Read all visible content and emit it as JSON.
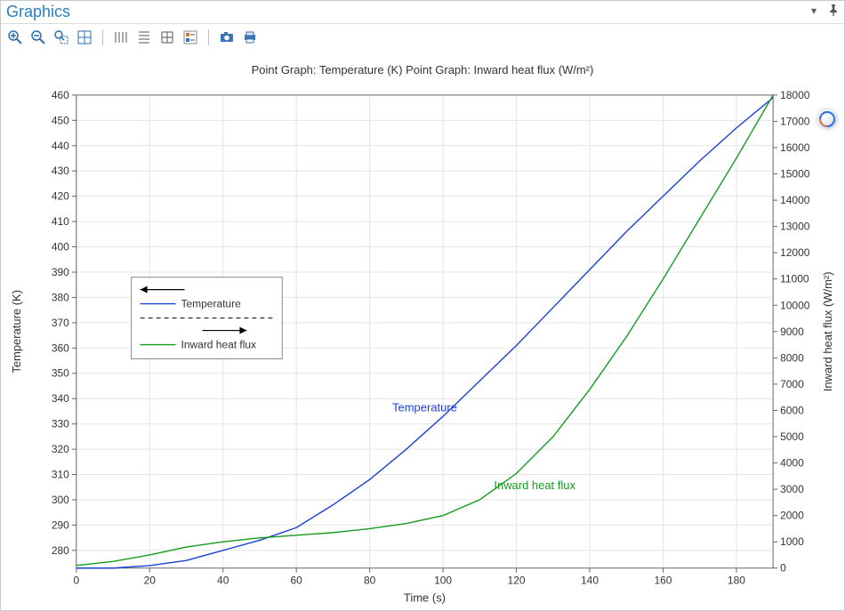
{
  "header": {
    "title": "Graphics"
  },
  "toolbar": {
    "icons": [
      "zoom-in-icon",
      "zoom-out-icon",
      "zoom-box-icon",
      "zoom-extents-icon",
      "sep",
      "grid-major-icon",
      "grid-minor-icon",
      "grid-lines-icon",
      "legend-toggle-icon",
      "sep",
      "camera-icon",
      "print-icon"
    ]
  },
  "chart_data": {
    "type": "line",
    "title": "Point Graph: Temperature (K)  Point Graph: Inward heat flux (W/m²)",
    "xlabel": "Time (s)",
    "ylabel_left": "Temperature (K)",
    "ylabel_right": "Inward heat flux (W/m²)",
    "xlim": [
      0,
      190
    ],
    "xticks": [
      0,
      20,
      40,
      60,
      80,
      100,
      120,
      140,
      160,
      180
    ],
    "ylim_left": [
      273,
      460
    ],
    "yticks_left": [
      280,
      290,
      300,
      310,
      320,
      330,
      340,
      350,
      360,
      370,
      380,
      390,
      400,
      410,
      420,
      430,
      440,
      450,
      460
    ],
    "ylim_right": [
      0,
      18000
    ],
    "yticks_right": [
      0,
      1000,
      2000,
      3000,
      4000,
      5000,
      6000,
      7000,
      8000,
      9000,
      10000,
      11000,
      12000,
      13000,
      14000,
      15000,
      16000,
      17000,
      18000
    ],
    "x": [
      0,
      10,
      20,
      30,
      40,
      50,
      60,
      70,
      80,
      90,
      100,
      110,
      120,
      130,
      140,
      150,
      160,
      170,
      180,
      190
    ],
    "series": [
      {
        "name": "Temperature",
        "axis": "left",
        "color": "#1b3fd4",
        "values": [
          273,
          273,
          274,
          276,
          280,
          284,
          289,
          298,
          308,
          320,
          333,
          347,
          361,
          376,
          391,
          406,
          420,
          434,
          447,
          459
        ]
      },
      {
        "name": "Inward heat flux",
        "axis": "right",
        "color": "#149b1e",
        "values": [
          100,
          250,
          500,
          800,
          1000,
          1150,
          1250,
          1350,
          1500,
          1700,
          2000,
          2600,
          3600,
          5000,
          6800,
          8800,
          11000,
          13300,
          15600,
          18000
        ]
      }
    ],
    "annotations": [
      {
        "text": "Temperature",
        "x": 95,
        "y_axis": "left",
        "y": 335,
        "color": "#1b3fd4"
      },
      {
        "text": "Inward heat flux",
        "x": 125,
        "y_axis": "right",
        "y": 3000,
        "color": "#149b1e"
      }
    ],
    "legend": {
      "position": {
        "x": 15,
        "y_left_value": 388
      },
      "items": [
        {
          "label": "Temperature",
          "style": "solid",
          "color": "#1b3fd4",
          "arrow": "left"
        },
        {
          "label": "Inward heat flux",
          "style": "solid",
          "color": "#149b1e",
          "arrow": "right"
        }
      ]
    }
  }
}
